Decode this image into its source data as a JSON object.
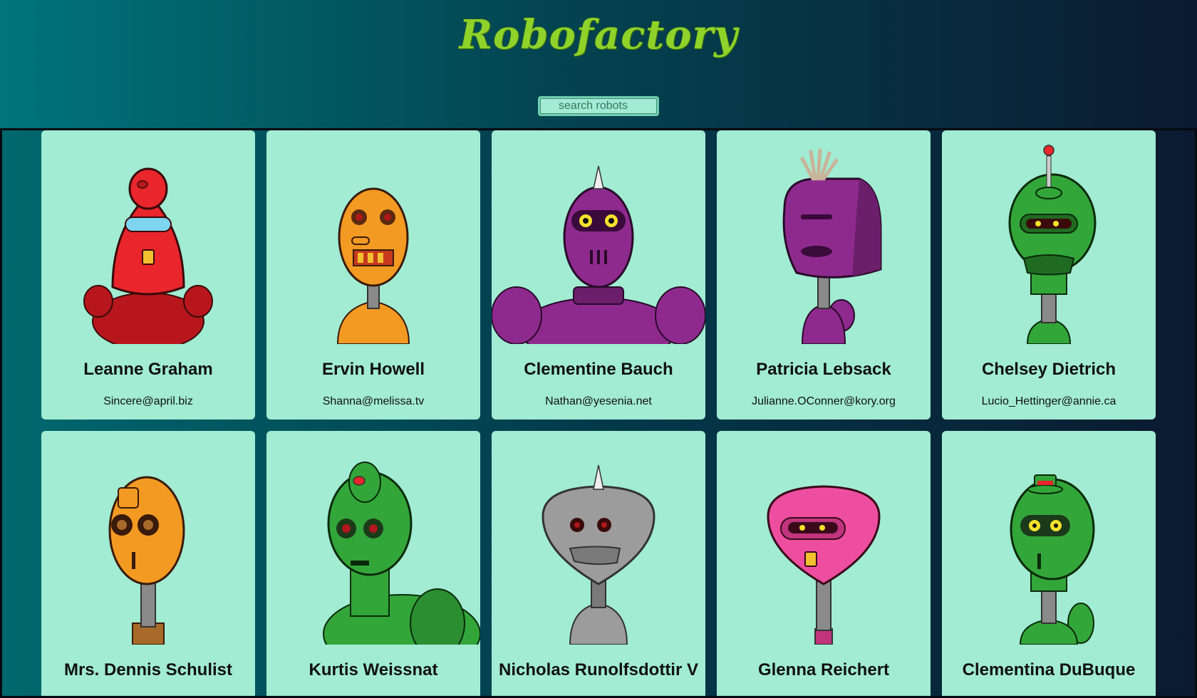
{
  "header": {
    "logo_text": "Robofactory",
    "search_placeholder": "search robots",
    "logo_color": "#8fd22a"
  },
  "robots": [
    {
      "name": "Leanne Graham",
      "email": "Sincere@april.biz",
      "color": "#e8262b"
    },
    {
      "name": "Ervin Howell",
      "email": "Shanna@melissa.tv",
      "color": "#f39a22"
    },
    {
      "name": "Clementine Bauch",
      "email": "Nathan@yesenia.net",
      "color": "#8e2a8e"
    },
    {
      "name": "Patricia Lebsack",
      "email": "Julianne.OConner@kory.org",
      "color": "#8e2a8e"
    },
    {
      "name": "Chelsey Dietrich",
      "email": "Lucio_Hettinger@annie.ca",
      "color": "#33a63a"
    },
    {
      "name": "Mrs. Dennis Schulist",
      "email": "",
      "color": "#f39a22"
    },
    {
      "name": "Kurtis Weissnat",
      "email": "",
      "color": "#33a63a"
    },
    {
      "name": "Nicholas Runolfsdottir V",
      "email": "",
      "color": "#9c9c9c"
    },
    {
      "name": "Glenna Reichert",
      "email": "",
      "color": "#ee4ea0"
    },
    {
      "name": "Clementina DuBuque",
      "email": "",
      "color": "#33a63a"
    }
  ]
}
